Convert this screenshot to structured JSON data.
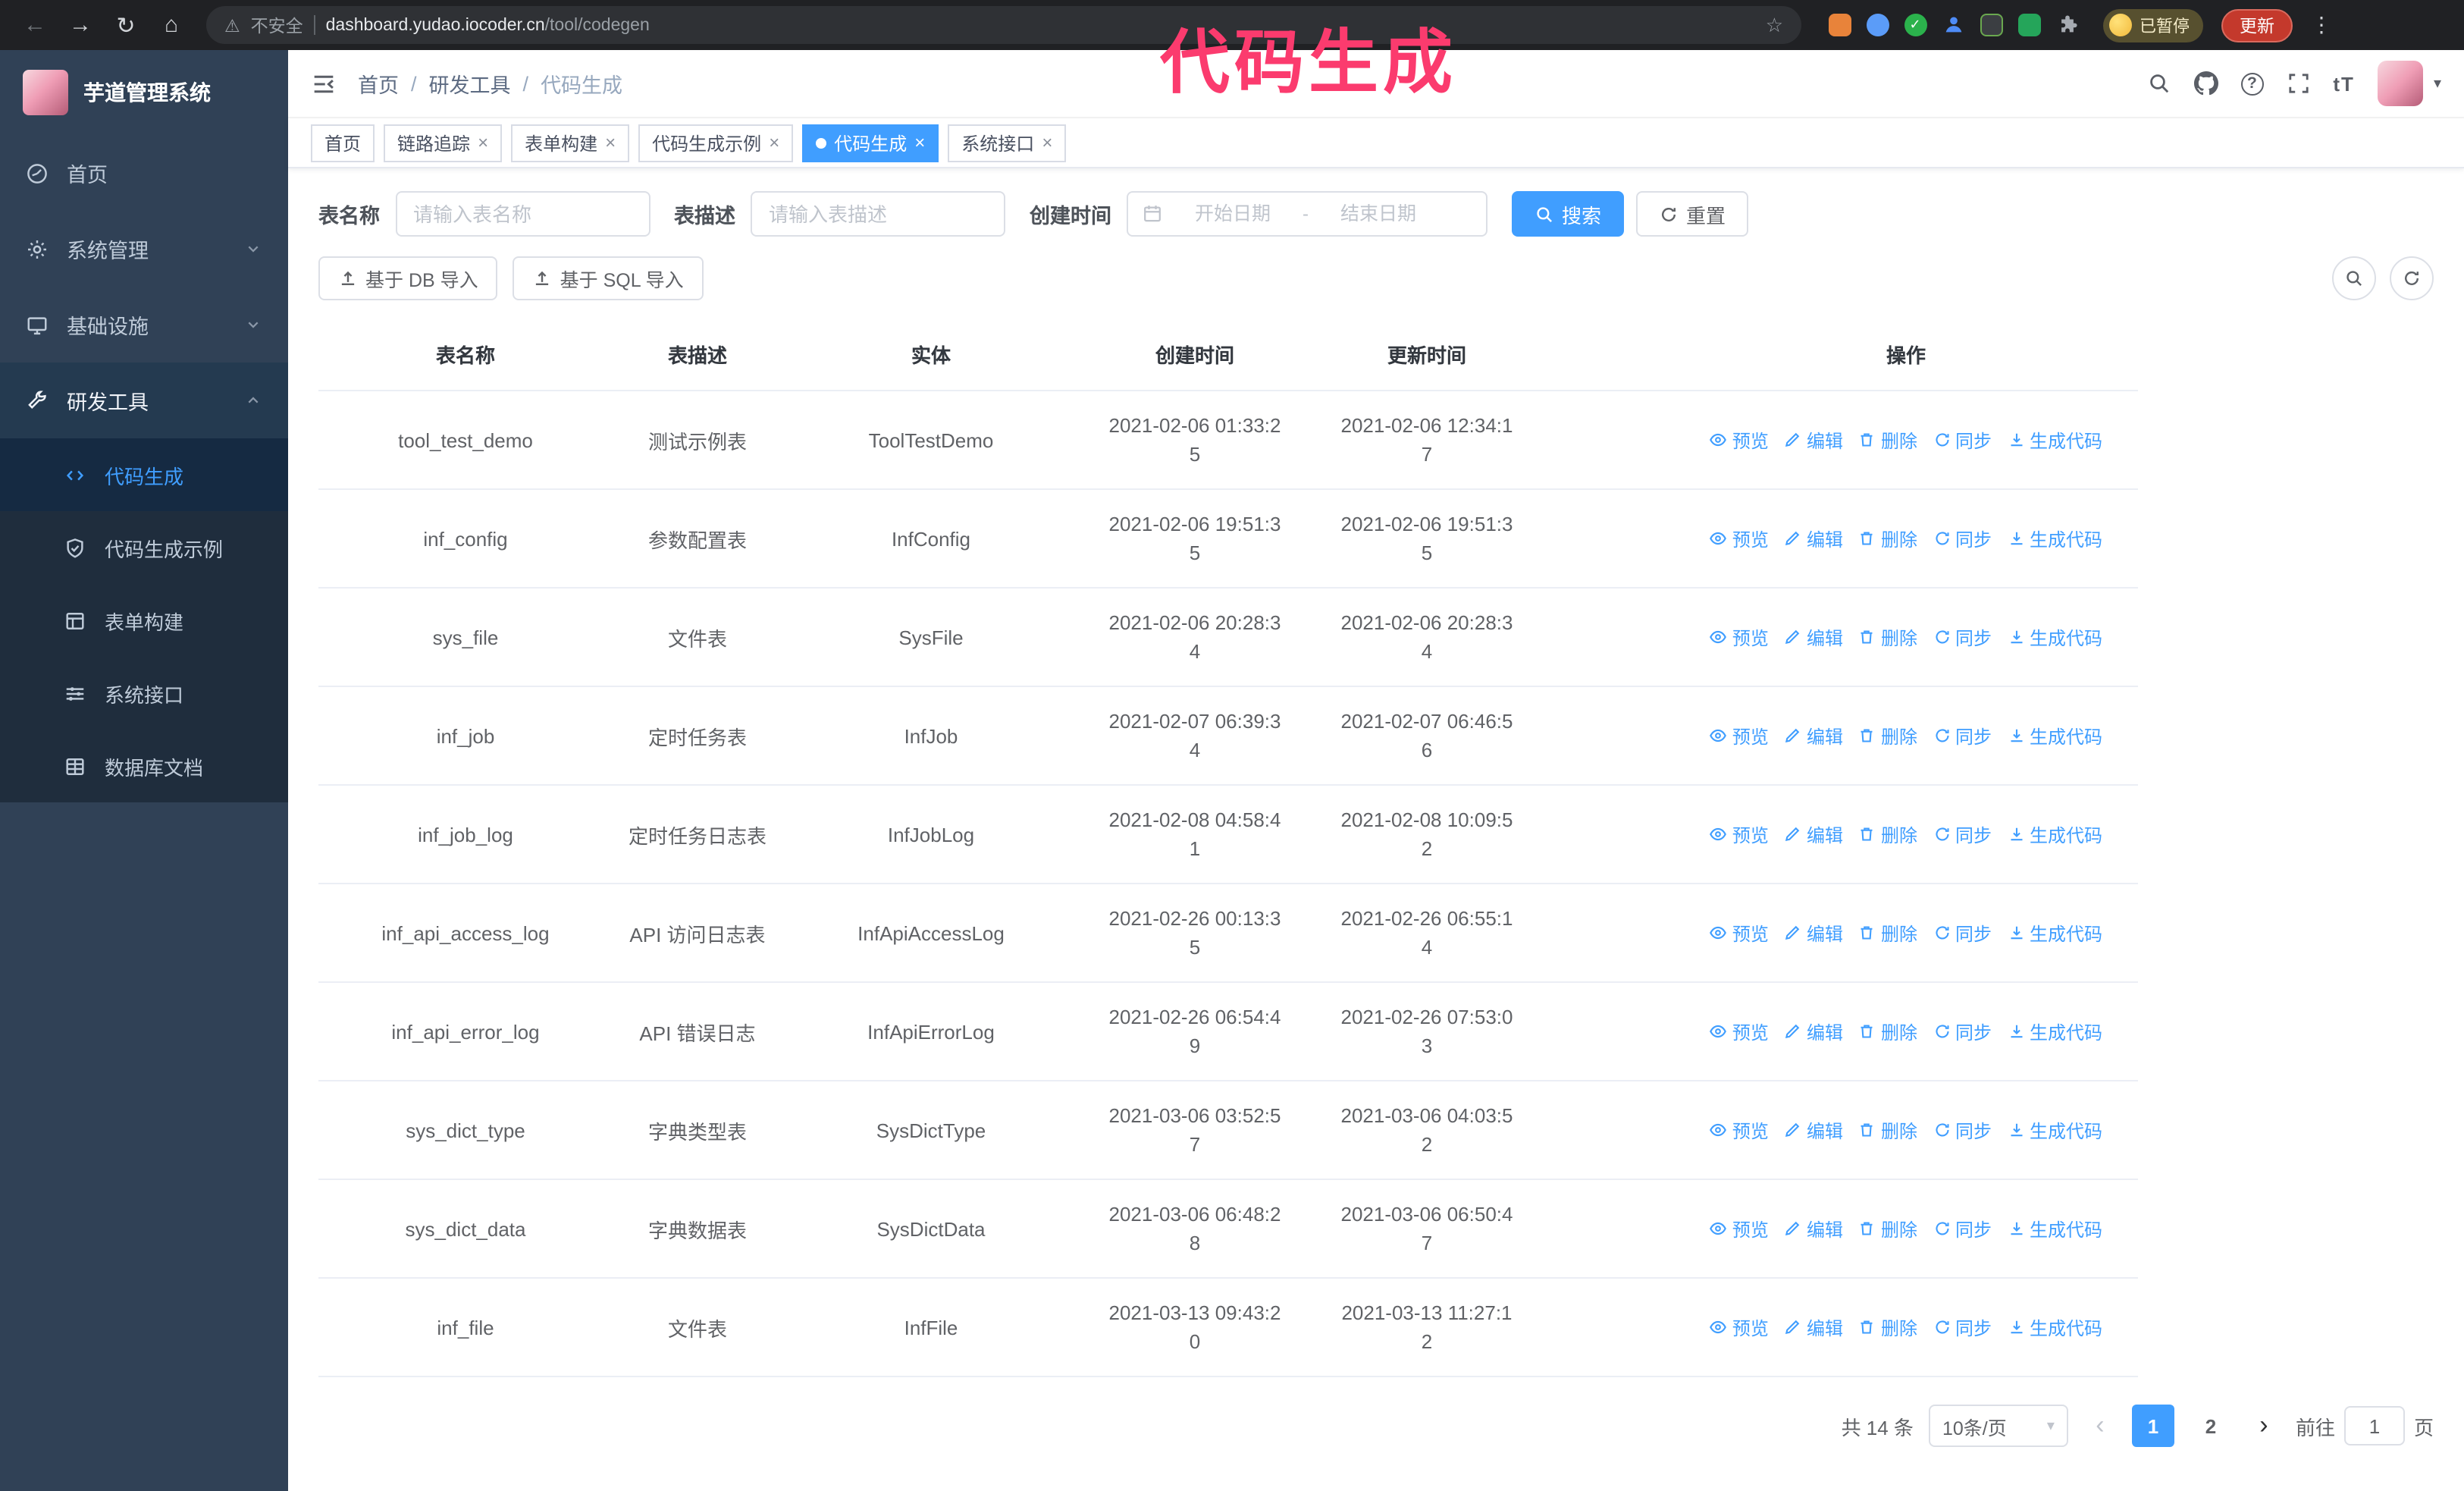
{
  "browser": {
    "security_label": "不安全",
    "url_host": "dashboard.yudao.iocoder.cn",
    "url_path": "/tool/codegen",
    "paused_badge": "已暂停",
    "update_button": "更新"
  },
  "icons": {
    "back": "←",
    "forward": "→",
    "reload": "↻",
    "home": "⌂",
    "warning": "⚠",
    "star": "☆",
    "kebab": "⋮",
    "check": "✓",
    "caret_down": "▾",
    "prev": "‹",
    "next": "›",
    "text_size": "tT",
    "close": "×"
  },
  "annotation": {
    "text": "代码生成",
    "color": "#fb3b6e"
  },
  "sidebar": {
    "app_title": "芋道管理系统",
    "items": [
      {
        "label": "首页"
      },
      {
        "label": "系统管理"
      },
      {
        "label": "基础设施"
      },
      {
        "label": "研发工具",
        "children": [
          {
            "label": "代码生成"
          },
          {
            "label": "代码生成示例"
          },
          {
            "label": "表单构建"
          },
          {
            "label": "系统接口"
          },
          {
            "label": "数据库文档"
          }
        ]
      }
    ]
  },
  "header": {
    "breadcrumb": [
      "首页",
      "研发工具",
      "代码生成"
    ],
    "breadcrumb_separator": "/"
  },
  "tags": [
    {
      "label": "首页",
      "closable": false,
      "active": false
    },
    {
      "label": "链路追踪",
      "closable": true,
      "active": false
    },
    {
      "label": "表单构建",
      "closable": true,
      "active": false
    },
    {
      "label": "代码生成示例",
      "closable": true,
      "active": false
    },
    {
      "label": "代码生成",
      "closable": true,
      "active": true
    },
    {
      "label": "系统接口",
      "closable": true,
      "active": false
    }
  ],
  "filters": {
    "table_name_label": "表名称",
    "table_name_placeholder": "请输入表名称",
    "table_desc_label": "表描述",
    "table_desc_placeholder": "请输入表描述",
    "create_time_label": "创建时间",
    "date_start_placeholder": "开始日期",
    "date_separator": "-",
    "date_end_placeholder": "结束日期",
    "search_button": "搜索",
    "reset_button": "重置"
  },
  "toolbar": {
    "import_db_button": "基于 DB 导入",
    "import_sql_button": "基于 SQL 导入"
  },
  "table": {
    "columns": [
      "表名称",
      "表描述",
      "实体",
      "创建时间",
      "更新时间",
      "操作"
    ],
    "actions": [
      "预览",
      "编辑",
      "删除",
      "同步",
      "生成代码"
    ],
    "action_keys": [
      "preview",
      "edit",
      "delete",
      "sync",
      "generate"
    ],
    "action_icons": [
      "eye-icon",
      "edit-icon",
      "delete-icon",
      "sync-icon",
      "download-icon"
    ],
    "rows": [
      {
        "name": "tool_test_demo",
        "desc": "测试示例表",
        "entity": "ToolTestDemo",
        "create_time": "2021-02-06 01:33:25",
        "update_time": "2021-02-06 12:34:17"
      },
      {
        "name": "inf_config",
        "desc": "参数配置表",
        "entity": "InfConfig",
        "create_time": "2021-02-06 19:51:35",
        "update_time": "2021-02-06 19:51:35"
      },
      {
        "name": "sys_file",
        "desc": "文件表",
        "entity": "SysFile",
        "create_time": "2021-02-06 20:28:34",
        "update_time": "2021-02-06 20:28:34"
      },
      {
        "name": "inf_job",
        "desc": "定时任务表",
        "entity": "InfJob",
        "create_time": "2021-02-07 06:39:34",
        "update_time": "2021-02-07 06:46:56"
      },
      {
        "name": "inf_job_log",
        "desc": "定时任务日志表",
        "entity": "InfJobLog",
        "create_time": "2021-02-08 04:58:41",
        "update_time": "2021-02-08 10:09:52"
      },
      {
        "name": "inf_api_access_log",
        "desc": "API 访问日志表",
        "entity": "InfApiAccessLog",
        "create_time": "2021-02-26 00:13:35",
        "update_time": "2021-02-26 06:55:14"
      },
      {
        "name": "inf_api_error_log",
        "desc": "API 错误日志",
        "entity": "InfApiErrorLog",
        "create_time": "2021-02-26 06:54:49",
        "update_time": "2021-02-26 07:53:03"
      },
      {
        "name": "sys_dict_type",
        "desc": "字典类型表",
        "entity": "SysDictType",
        "create_time": "2021-03-06 03:52:57",
        "update_time": "2021-03-06 04:03:52"
      },
      {
        "name": "sys_dict_data",
        "desc": "字典数据表",
        "entity": "SysDictData",
        "create_time": "2021-03-06 06:48:28",
        "update_time": "2021-03-06 06:50:47"
      },
      {
        "name": "inf_file",
        "desc": "文件表",
        "entity": "InfFile",
        "create_time": "2021-03-13 09:43:20",
        "update_time": "2021-03-13 11:27:12"
      }
    ]
  },
  "pagination": {
    "total_text": "共 14 条",
    "page_size": "10条/页",
    "pages": [
      "1",
      "2"
    ],
    "active_page": "1",
    "goto_label": "前往",
    "goto_value": "1",
    "goto_suffix": "页"
  }
}
